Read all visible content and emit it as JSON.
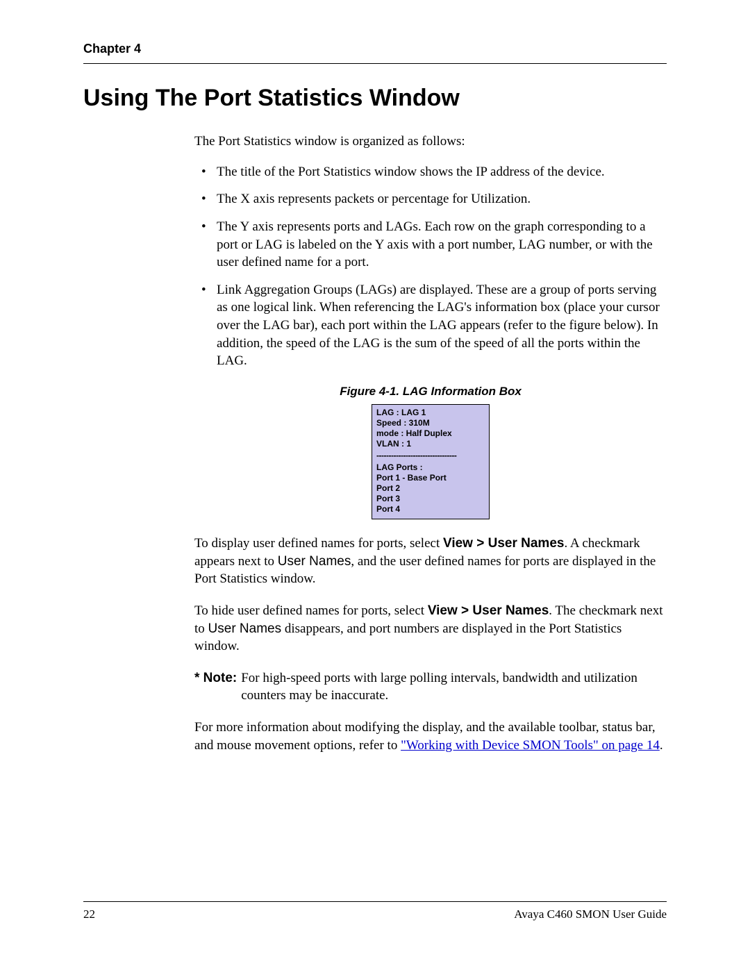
{
  "header": {
    "chapter_label": "Chapter 4"
  },
  "title": "Using The Port Statistics Window",
  "body": {
    "intro": "The Port Statistics window is organized as follows:",
    "bullets": [
      "The title of the Port Statistics window shows the IP address of the device.",
      "The X axis represents packets or percentage for Utilization.",
      "The Y axis represents ports and LAGs. Each row on the graph corresponding to a port or LAG is labeled on the Y axis with a port number, LAG number, or with the user defined name for a port.",
      "Link Aggregation Groups (LAGs) are displayed. These are a group of ports serving as one logical link. When referencing the LAG's information box (place your cursor over the LAG bar), each port within the LAG appears (refer to the figure below). In addition, the speed of the LAG is the sum of the speed of all the ports within the LAG."
    ],
    "figure_caption": "Figure 4-1.  LAG Information Box",
    "lagbox": {
      "line1": "LAG  : LAG 1",
      "line2": "Speed : 310M",
      "line3": "mode  : Half Duplex",
      "line4": "VLAN  : 1",
      "sep": "---------------------------------",
      "line5": "LAG Ports :",
      "line6": "Port 1 - Base Port",
      "line7": "Port 2",
      "line8": "Port 3",
      "line9": "Port 4"
    },
    "p1_a": "To display user defined names for ports, select ",
    "p1_bold": "View > User Names",
    "p1_b": ". A checkmark appears next to ",
    "p1_menu": "User Names",
    "p1_c": ", and the user defined names for ports are displayed in the Port Statistics window.",
    "p2_a": "To hide user defined names for ports, select ",
    "p2_bold": "View > User Names",
    "p2_b": ". The checkmark next to ",
    "p2_menu": "User Names",
    "p2_c": " disappears, and port numbers are displayed in the Port Statistics window.",
    "note_label": "* Note:",
    "note_text": "For high-speed ports with large polling intervals, bandwidth and utilization counters may be inaccurate.",
    "p3_a": "For more information about modifying the display, and the available toolbar, status bar, and mouse movement options, refer to ",
    "p3_link": "\"Working with Device SMON Tools\" on page 14",
    "p3_b": "."
  },
  "footer": {
    "page_number": "22",
    "doc_title": "Avaya C460 SMON User Guide"
  }
}
